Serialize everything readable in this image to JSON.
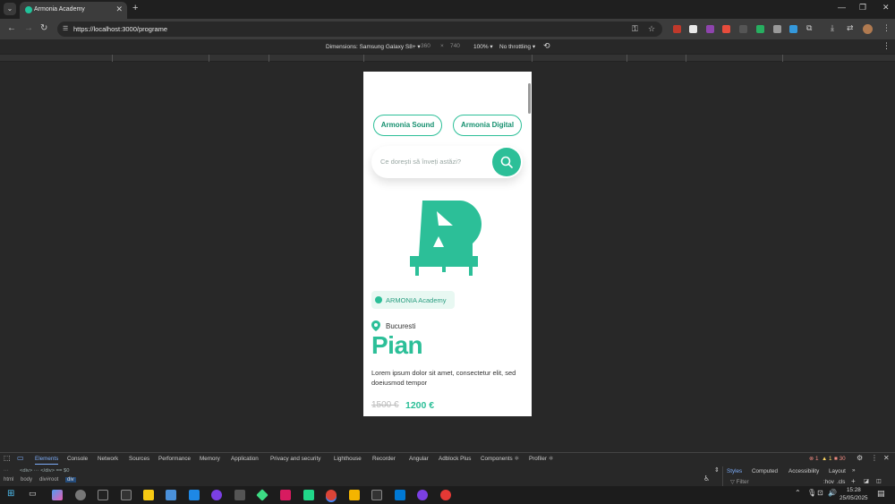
{
  "browser": {
    "tab": {
      "title": "Armonia Academy"
    },
    "url": "https://localhost:3000/programe",
    "device_toolbar": {
      "dimensions_label": "Dimensions: Samsung Galaxy S8+",
      "width": "360",
      "times": "×",
      "height": "740",
      "zoom": "100%",
      "throttling": "No throttling"
    }
  },
  "page": {
    "pills": [
      "Armonia Sound",
      "Armonia Digital"
    ],
    "search_placeholder": "Ce dorești să înveți astăzi?",
    "badge": "ARMONIA Academy",
    "location": "Bucuresti",
    "title": "Pian",
    "description": "Lorem ipsum dolor sit amet, consectetur elit, sed doeiusmod tempor",
    "old_price": "1500 €",
    "new_price": "1200 €"
  },
  "devtools": {
    "tabs": [
      "Elements",
      "Console",
      "Network",
      "Sources",
      "Performance",
      "Memory",
      "Application",
      "Privacy and security",
      "Lighthouse",
      "Recorder",
      "Angular",
      "Adblock Plus",
      "Components ⚛",
      "Profiler ⚛"
    ],
    "active_tab": "Elements",
    "counts": {
      "errors": "1",
      "warnings": "1",
      "info": "30"
    },
    "dom_line": "<div> ⋯ </div> == $0",
    "breadcrumbs": [
      "html",
      "body",
      "div#root",
      "div"
    ],
    "side_tabs": [
      "Styles",
      "Computed",
      "Accessibility",
      "Layout"
    ],
    "filter_placeholder": "Filter",
    "filter_hov": ":hov",
    "filter_cls": ".cls"
  },
  "taskbar": {
    "time": "15:28",
    "date": "25/05/2025"
  },
  "colors": {
    "accent": "#2cbf98",
    "accent_dark": "#15906f"
  }
}
